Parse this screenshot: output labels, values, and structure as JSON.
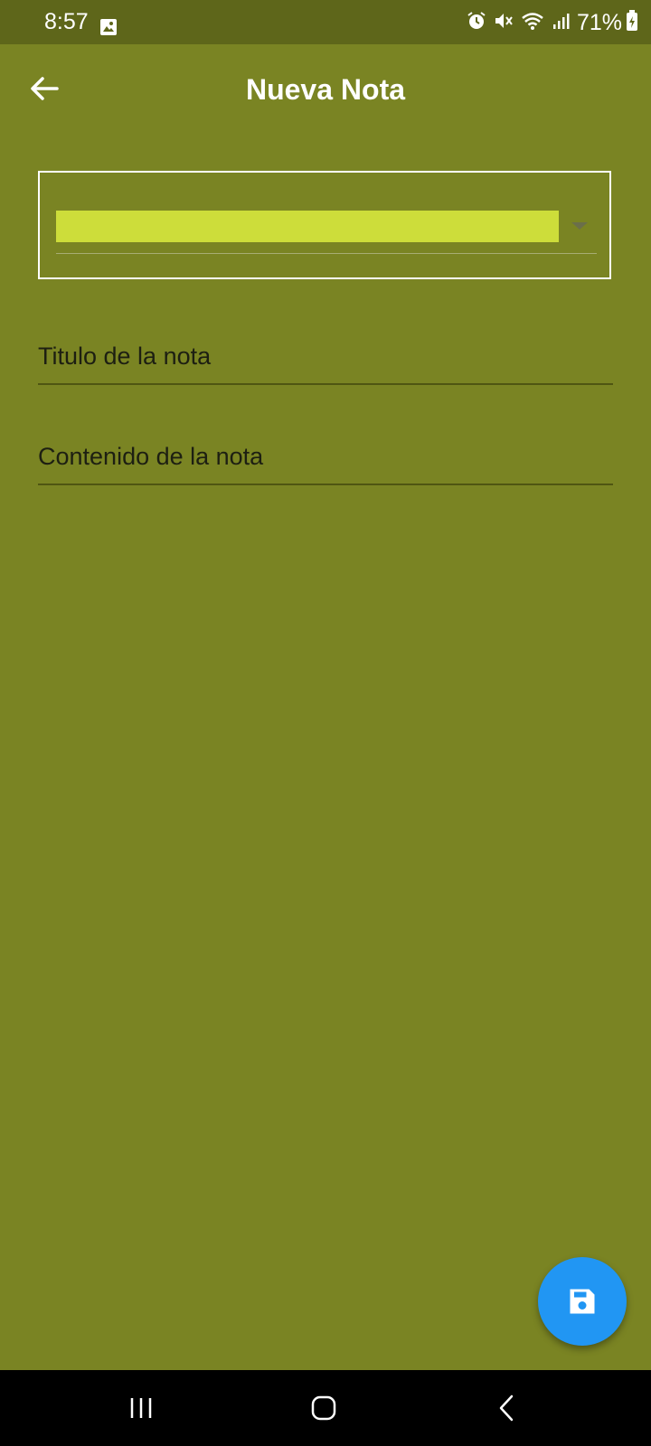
{
  "status_bar": {
    "time": "8:57",
    "battery": "71%",
    "icons": [
      "image-icon",
      "alarm-icon",
      "mute-icon",
      "wifi-icon",
      "signal-icon",
      "battery-charging-icon"
    ]
  },
  "header": {
    "title": "Nueva Nota",
    "back_icon": "arrow-left-icon"
  },
  "form": {
    "category_dropdown": {
      "selected_value": "",
      "selected_color": "#cddd3a"
    },
    "title_field": {
      "placeholder": "Titulo de la nota",
      "value": ""
    },
    "content_field": {
      "placeholder": "Contenido de la nota",
      "value": ""
    }
  },
  "fab": {
    "icon": "save-icon",
    "color": "#2196f3"
  },
  "nav_bar": {
    "buttons": [
      "recent-apps-icon",
      "home-icon",
      "back-icon"
    ]
  },
  "colors": {
    "background": "#7a8423",
    "status_bar": "#5e661a"
  }
}
